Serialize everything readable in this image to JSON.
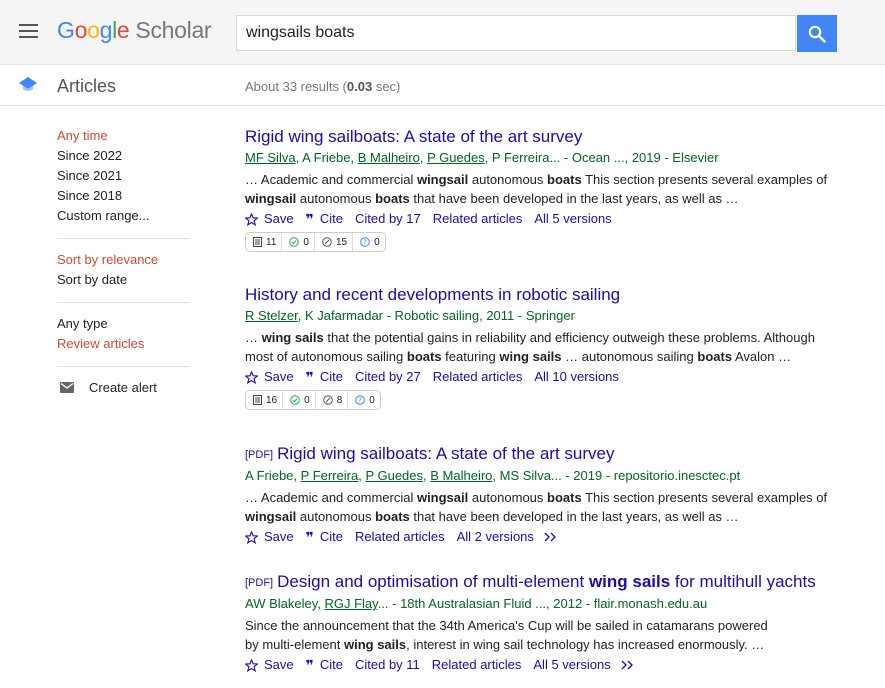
{
  "search": {
    "query": "wingsails boats"
  },
  "section_title": "Articles",
  "result_count": {
    "prefix": "About 33 results (",
    "time": "0.03",
    "suffix": " sec)"
  },
  "sidebar": {
    "time_filters": [
      "Any time",
      "Since 2022",
      "Since 2021",
      "Since 2018",
      "Custom range..."
    ],
    "sort_options": [
      "Sort by relevance",
      "Sort by date"
    ],
    "type_filters": [
      "Any type",
      "Review articles"
    ],
    "create_alert": "Create alert"
  },
  "actions": {
    "save": "Save",
    "cite": "Cite",
    "related": "Related articles"
  },
  "colors": {
    "accent": "#4285f4",
    "link": "#1a0dab",
    "meta": "#006621",
    "selected": "#d14836"
  },
  "results": [
    {
      "pdf_tag": "",
      "title": "Rigid wing sailboats: A state of the art survey",
      "authors_linked": [
        "MF Silva",
        "B Malheiro",
        "P Guedes"
      ],
      "meta": "MF Silva, A Friebe, B Malheiro, P Guedes, P Ferreira... - Ocean ..., 2019 - Elsevier",
      "snippet": "… Academic and commercial wingsail autonomous boats This section presents several examples of wingsail autonomous boats that have been developed in the last years, as well as …",
      "cited_by": "Cited by 17",
      "versions": "All 5 versions",
      "badge": [
        "11",
        "0",
        "15",
        "0"
      ]
    },
    {
      "pdf_tag": "",
      "title": "History and recent developments in robotic sailing",
      "meta": "R Stelzer, K Jafarmadar - Robotic sailing, 2011 - Springer",
      "snippet": "… wing sails that the potential gains in reliability and efficiency outweigh these problems. Although most of autonomous sailing boats featuring wing sails … autonomous sailing boats Avalon …",
      "cited_by": "Cited by 27",
      "versions": "All 10 versions",
      "badge": [
        "16",
        "0",
        "8",
        "0"
      ]
    },
    {
      "pdf_tag": "[PDF]",
      "title": "Rigid wing sailboats: A state of the art survey",
      "meta": "A Friebe, P Ferreira, P Guedes, B Malheiro, MS Silva... - 2019 - repositorio.inesctec.pt",
      "snippet": "… Academic and commercial wingsail autonomous boats This section presents several examples of wingsail autonomous boats that have been developed in the last years, as well as …",
      "cited_by": "",
      "versions": "All 2 versions"
    },
    {
      "pdf_tag": "[PDF]",
      "title": "Design and optimisation of multi-element wing sails for multihull yachts",
      "meta": "AW Blakeley, RGJ Flay... - 18th Australasian Fluid ..., 2012 - flair.monash.edu.au",
      "snippet": "Since the announcement that the 34th America's Cup will be sailed in catamarans powered by multi-element wing sails, interest in wing sail technology has increased enormously. …",
      "cited_by": "Cited by 11",
      "versions": "All 5 versions"
    }
  ]
}
